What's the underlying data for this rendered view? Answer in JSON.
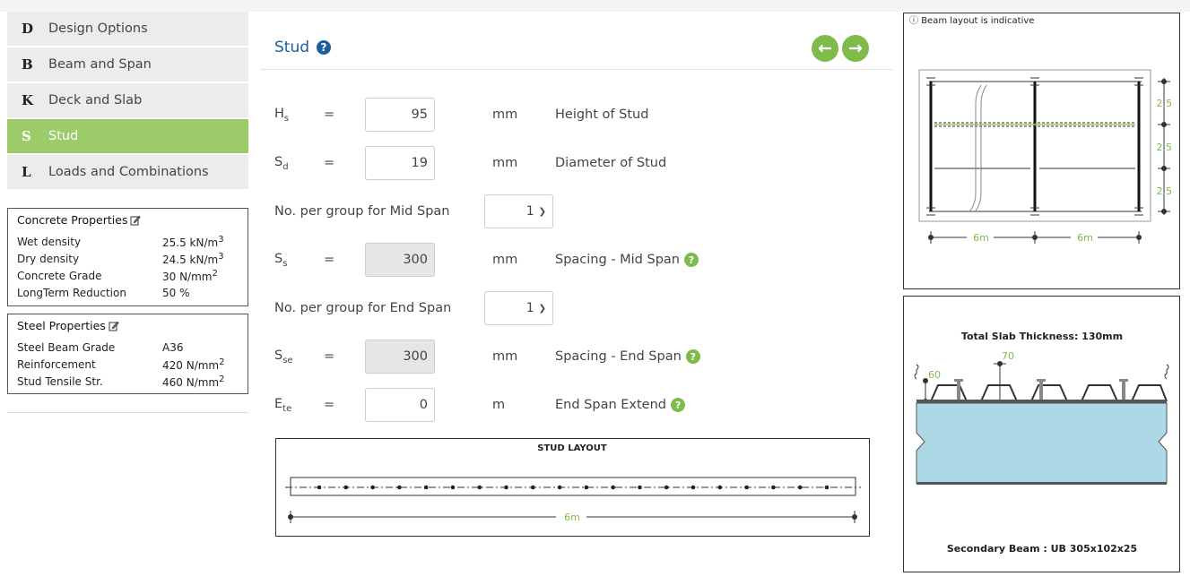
{
  "nav": [
    {
      "letter": "D",
      "label": "Design Options",
      "active": false
    },
    {
      "letter": "B",
      "label": "Beam and Span",
      "active": false
    },
    {
      "letter": "K",
      "label": "Deck and Slab",
      "active": false
    },
    {
      "letter": "S",
      "label": "Stud",
      "active": true
    },
    {
      "letter": "L",
      "label": "Loads and Combinations",
      "active": false
    }
  ],
  "concrete": {
    "title": "Concrete Properties",
    "rows": [
      {
        "label": "Wet density",
        "value": "25.5 kN/m",
        "sup": "3"
      },
      {
        "label": "Dry density",
        "value": "24.5 kN/m",
        "sup": "3"
      },
      {
        "label": "Concrete Grade",
        "value": "30 N/mm",
        "sup": "2"
      },
      {
        "label": "LongTerm Reduction",
        "value": "50 %",
        "sup": ""
      }
    ]
  },
  "steel": {
    "title": "Steel Properties",
    "rows": [
      {
        "label": "Steel Beam Grade",
        "value": "A36",
        "sup": ""
      },
      {
        "label": "Reinforcement",
        "value": "420 N/mm",
        "sup": "2"
      },
      {
        "label": "Stud Tensile Str.",
        "value": "460 N/mm",
        "sup": "2"
      }
    ]
  },
  "section": {
    "title": "Stud",
    "help": "?"
  },
  "fields": {
    "hs": {
      "sym": "H",
      "sub": "s",
      "eq": "=",
      "value": "95",
      "unit": "mm",
      "desc": "Height of Stud"
    },
    "sd": {
      "sym": "S",
      "sub": "d",
      "eq": "=",
      "value": "19",
      "unit": "mm",
      "desc": "Diameter of Stud"
    },
    "ss": {
      "sym": "S",
      "sub": "s",
      "eq": "=",
      "value": "300",
      "unit": "mm",
      "desc": "Spacing - Mid Span"
    },
    "sse": {
      "sym": "S",
      "sub": "se",
      "eq": "=",
      "value": "300",
      "unit": "mm",
      "desc": "Spacing - End Span"
    },
    "ete": {
      "sym": "E",
      "sub": "te",
      "eq": "=",
      "value": "0",
      "unit": "m",
      "desc": "End Span Extend"
    }
  },
  "mid_group": {
    "label": "No. per group for Mid Span",
    "value": "1"
  },
  "end_group": {
    "label": "No. per group for End Span",
    "value": "1"
  },
  "stud_layout": {
    "title": "STUD LAYOUT",
    "span": "6m",
    "stud_count": 20
  },
  "beam_layout": {
    "note": "Beam layout is indicative",
    "spacing": [
      "2.5",
      "2.5",
      "2.5"
    ],
    "spans": [
      "6m",
      "6m"
    ]
  },
  "slab": {
    "title": "Total Slab Thickness: 130mm",
    "dim_top": "70",
    "dim_left": "60",
    "beam": "Secondary Beam : UB 305x102x25"
  },
  "colors": {
    "accent": "#9ccb6a",
    "green": "#7ebb4b",
    "blue": "#1a5e9e",
    "slab": "#add8e6"
  }
}
